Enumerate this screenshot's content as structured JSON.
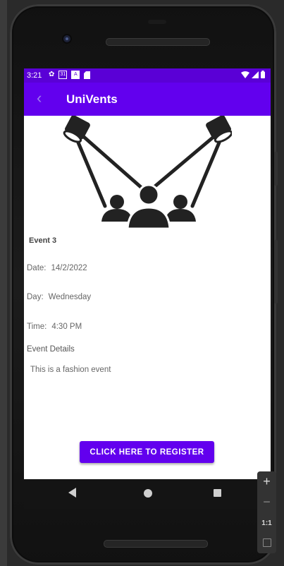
{
  "status_bar": {
    "time": "3:21",
    "calendar_day": "31"
  },
  "app_bar": {
    "title": "UniVents"
  },
  "event": {
    "title": "Event 3",
    "date_label": "Date:",
    "date_value": "14/2/2022",
    "day_label": "Day:",
    "day_value": "Wednesday",
    "time_label": "Time:",
    "time_value": "4:30 PM",
    "details_label": "Event Details",
    "details_text": "This is a fashion event"
  },
  "register_button": {
    "label": "CLICK HERE TO REGISTER"
  },
  "emulator_zoom": {
    "plus": "+",
    "minus": "−",
    "ratio": "1:1"
  },
  "colors": {
    "primary": "#6200ee",
    "status_bar": "#5a00d6"
  },
  "icons": {
    "status": [
      "settings-gear-icon",
      "calendar-icon",
      "a-notification-icon",
      "sd-card-icon",
      "wifi-icon",
      "signal-icon",
      "battery-icon"
    ],
    "app_bar": "back-arrow-icon",
    "hero": "spotlights-audience-icon",
    "nav": [
      "nav-back-icon",
      "nav-home-icon",
      "nav-recents-icon"
    ]
  }
}
